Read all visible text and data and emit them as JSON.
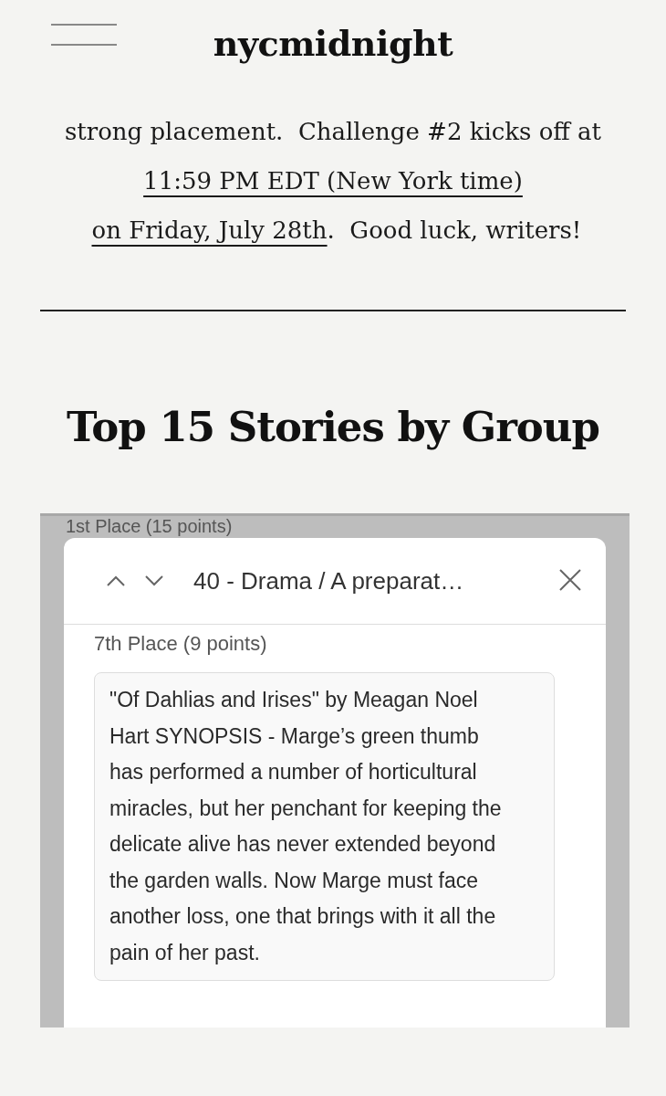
{
  "site_header": {
    "title": "nycmidnight"
  },
  "paragraph": [
    {
      "kind": "text",
      "text": "strong placement.  Challenge #2 kicks off at "
    },
    {
      "kind": "link",
      "text": "11:59 PM EDT (New York time)"
    },
    {
      "kind": "link",
      "text": "on Friday, July 28th"
    },
    {
      "kind": "text",
      "text": ".  Good luck, writers!"
    }
  ],
  "section_heading": "Top 15 Stories by Group",
  "embed": {
    "background_label": "1st Place (15 points)",
    "dialog": {
      "title": "40 - Drama / A preparat…",
      "place": "7th Place (9 points)",
      "synopsis": "\"Of Dahlias and Irises\" by Meagan Noel Hart  SYNOPSIS - Marge’s green thumb has performed a number of horticultural miracles, but her penchant for keeping the delicate alive has never extended beyond the garden walls. Now Marge must face another loss, one that brings with it all the pain of her past."
    }
  }
}
